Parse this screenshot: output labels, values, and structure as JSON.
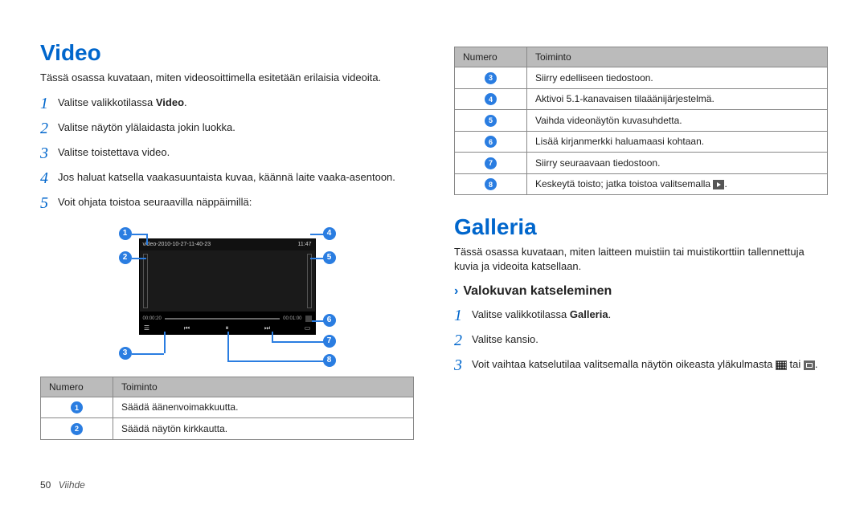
{
  "left": {
    "heading": "Video",
    "intro": "Tässä osassa kuvataan, miten videosoittimella esitetään erilaisia videoita.",
    "steps": [
      {
        "n": "1",
        "pre": "Valitse valikkotilassa ",
        "bold": "Video",
        "post": "."
      },
      {
        "n": "2",
        "text": "Valitse näytön ylälaidasta jokin luokka."
      },
      {
        "n": "3",
        "text": "Valitse toistettava video."
      },
      {
        "n": "4",
        "text": "Jos haluat katsella vaakasuuntaista kuvaa, käännä laite vaaka-asentoon."
      },
      {
        "n": "5",
        "text": "Voit ohjata toistoa seuraavilla näppäimillä:"
      }
    ],
    "player": {
      "topleft": "video-2010-10-27-11-40-23",
      "topright": "11:47",
      "time_l": "00:00:20",
      "time_r": "00:01:00"
    },
    "table_head": {
      "a": "Numero",
      "b": "Toiminto"
    },
    "table": [
      {
        "n": "1",
        "t": "Säädä äänenvoimakkuutta."
      },
      {
        "n": "2",
        "t": "Säädä näytön kirkkautta."
      }
    ]
  },
  "right": {
    "table_head": {
      "a": "Numero",
      "b": "Toiminto"
    },
    "table": [
      {
        "n": "3",
        "t": "Siirry edelliseen tiedostoon."
      },
      {
        "n": "4",
        "t": "Aktivoi 5.1-kanavaisen tilaäänijärjestelmä."
      },
      {
        "n": "5",
        "t": "Vaihda videonäytön kuvasuhdetta."
      },
      {
        "n": "6",
        "t": "Lisää kirjanmerkki haluamaasi kohtaan."
      },
      {
        "n": "7",
        "t": "Siirry seuraavaan tiedostoon."
      },
      {
        "n": "8",
        "t_pre": "Keskeytä toisto; jatka toistoa valitsemalla ",
        "icon": "play",
        "t_post": "."
      }
    ],
    "galleria": {
      "heading": "Galleria",
      "intro": "Tässä osassa kuvataan, miten laitteen muistiin tai muistikorttiin tallennettuja kuvia ja videoita katsellaan.",
      "subhead": "Valokuvan katseleminen",
      "steps": [
        {
          "n": "1",
          "pre": "Valitse valikkotilassa ",
          "bold": "Galleria",
          "post": "."
        },
        {
          "n": "2",
          "text": "Valitse kansio."
        },
        {
          "n": "3",
          "pre": "Voit vaihtaa katselutilaa valitsemalla näytön oikeasta yläkulmasta ",
          "icon1": "grid",
          "mid": " tai ",
          "icon2": "card",
          "post": "."
        }
      ]
    }
  },
  "footer": {
    "page": "50",
    "section": "Viihde"
  }
}
